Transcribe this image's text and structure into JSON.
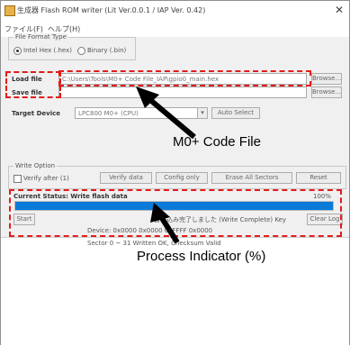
{
  "window": {
    "title": "生成器 Flash ROM writer (Lit Ver.0.0.1 / IAP Ver. 0.42)",
    "close_glyph": "✕"
  },
  "menu": {
    "file": "ファイル(F)",
    "help": "ヘルプ(H)"
  },
  "format_group": {
    "legend": "File Format Type",
    "option1": "Intel Hex (.hex)",
    "option2": "Binary (.bin)",
    "selected": "option1"
  },
  "load_file": {
    "label": "Load file",
    "value": "C:\\Users\\Tools\\M0+ Code File_IAP\\gpio0_main.hex",
    "button": "Browse..."
  },
  "save_file": {
    "label": "Save file",
    "value": "",
    "button": "Browse..."
  },
  "target": {
    "label": "Target Device",
    "value": "LPC800 M0+ (CPU)",
    "button": "Auto Select"
  },
  "write_option": {
    "legend": "Write Option",
    "checkbox_label": "Verify after (1)",
    "buttons": [
      "Verify data",
      "Config only",
      "Erase All Sectors",
      "Reset"
    ]
  },
  "status": {
    "label": "Current Status: Write flash data",
    "percent_label": "100%",
    "progress_fraction": 1.0,
    "start_button": "Start",
    "info_line": "書き込み完了しました (Write Complete) Key",
    "clear_button": "Clear Log",
    "line2": "Device: 0x0000 0x0000 0xFFFF 0x0000",
    "line3": "Sector 0 ~ 31 Written OK, Checksum Valid"
  },
  "annotations": {
    "code_file": "M0+ Code File",
    "progress": "Process Indicator (%)",
    "dash_color": "#e31b1b"
  },
  "colors": {
    "accent": "#0a7ad8"
  }
}
